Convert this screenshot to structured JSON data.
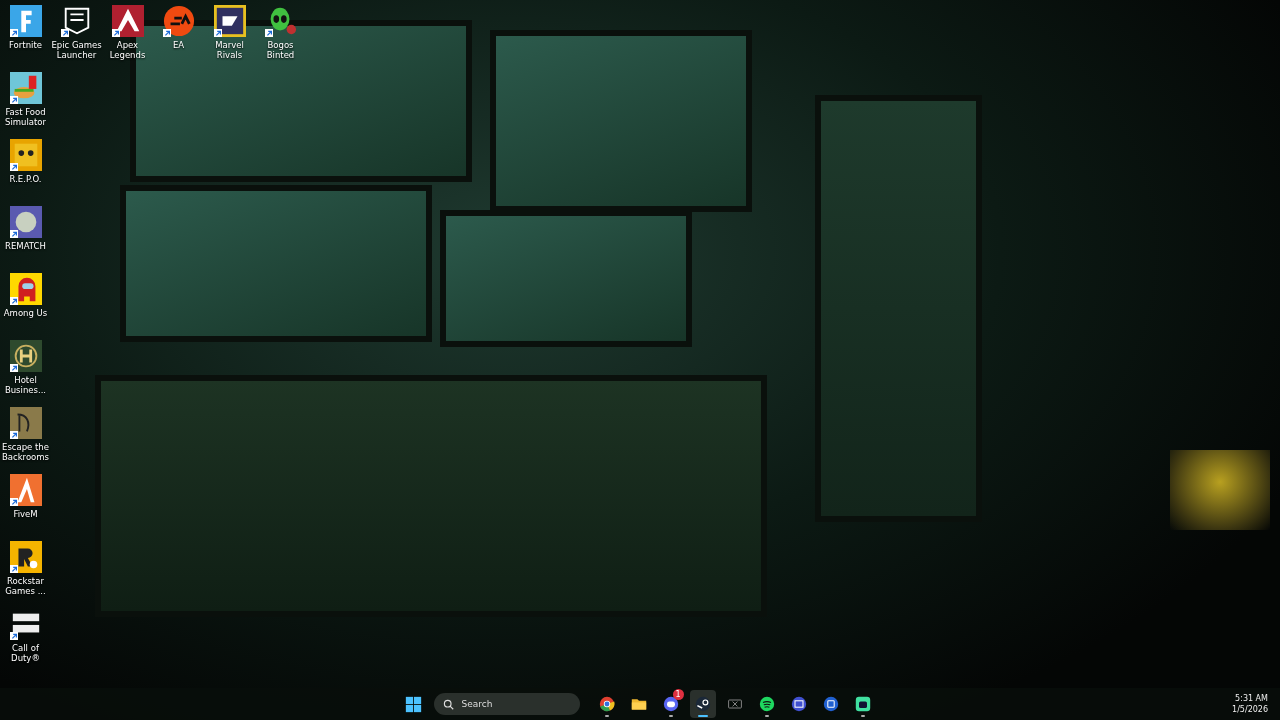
{
  "desktop_icons": [
    {
      "label": "Fortnite",
      "shortcut": true
    },
    {
      "label": "Epic Games Launcher",
      "shortcut": true
    },
    {
      "label": "Apex Legends",
      "shortcut": true
    },
    {
      "label": "EA",
      "shortcut": true
    },
    {
      "label": "Marvel Rivals",
      "shortcut": true
    },
    {
      "label": "Bogos Binted",
      "shortcut": true
    },
    {
      "label": "Fast Food Simulator",
      "shortcut": true
    },
    {
      "label": "R.E.P.O.",
      "shortcut": true
    },
    {
      "label": "REMATCH",
      "shortcut": true
    },
    {
      "label": "Among Us",
      "shortcut": true
    },
    {
      "label": "Hotel Busines...",
      "shortcut": true
    },
    {
      "label": "Escape the Backrooms",
      "shortcut": true
    },
    {
      "label": "FiveM",
      "shortcut": true
    },
    {
      "label": "Rockstar Games ...",
      "shortcut": true
    },
    {
      "label": "Call of Duty®",
      "shortcut": true
    }
  ],
  "taskbar": {
    "search": {
      "placeholder": "Search"
    },
    "apps": [
      {
        "running": true,
        "selected": false
      },
      {
        "running": false,
        "selected": false
      },
      {
        "running": true,
        "selected": false,
        "badge": "1"
      },
      {
        "running": true,
        "selected": true
      },
      {
        "running": false,
        "selected": false
      },
      {
        "running": true,
        "selected": false
      },
      {
        "running": false,
        "selected": false
      },
      {
        "running": false,
        "selected": false
      },
      {
        "running": true,
        "selected": false
      }
    ],
    "clock": {
      "time": "5:31 AM",
      "date": "1/5/2026"
    }
  }
}
